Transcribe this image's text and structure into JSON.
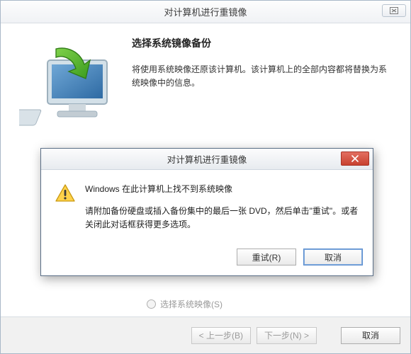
{
  "wizard": {
    "title": "对计算机进行重镜像",
    "heading": "选择系统镜像备份",
    "description": "将使用系统映像还原该计算机。该计算机上的全部内容都将替换为系统映像中的信息。",
    "radio_select_image_label": "选择系统映像(S)",
    "buttons": {
      "back": "< 上一步(B)",
      "next": "下一步(N) >",
      "cancel": "取消"
    }
  },
  "dialog": {
    "title": "对计算机进行重镜像",
    "message_primary": "Windows 在此计算机上找不到系统映像",
    "message_secondary": "请附加备份硬盘或插入备份集中的最后一张 DVD，然后单击\"重试\"。或者关闭此对话框获得更多选项。",
    "retry": "重试(R)",
    "cancel": "取消"
  }
}
